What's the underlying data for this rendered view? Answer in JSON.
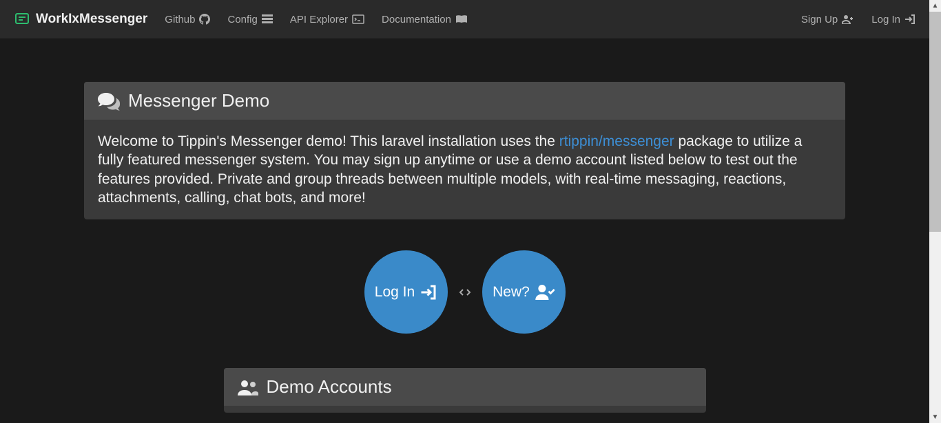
{
  "brand": {
    "name": "WorkIxMessenger"
  },
  "nav": {
    "github": "Github",
    "config": "Config",
    "api_explorer": "API Explorer",
    "documentation": "Documentation",
    "signup": "Sign Up",
    "login": "Log In"
  },
  "card": {
    "title": "Messenger Demo",
    "body_before": "Welcome to Tippin's Messenger demo! This laravel installation uses the ",
    "body_link": "rtippin/messenger",
    "body_after": " package to utilize a fully featured messenger system. You may sign up anytime or use a demo account listed below to test out the features provided. Private and group threads between multiple models, with real-time messaging, reactions, attachments, calling, chat bots, and more!"
  },
  "actions": {
    "login": "Log In",
    "new": "New?"
  },
  "demo_accounts": {
    "title": "Demo Accounts"
  }
}
